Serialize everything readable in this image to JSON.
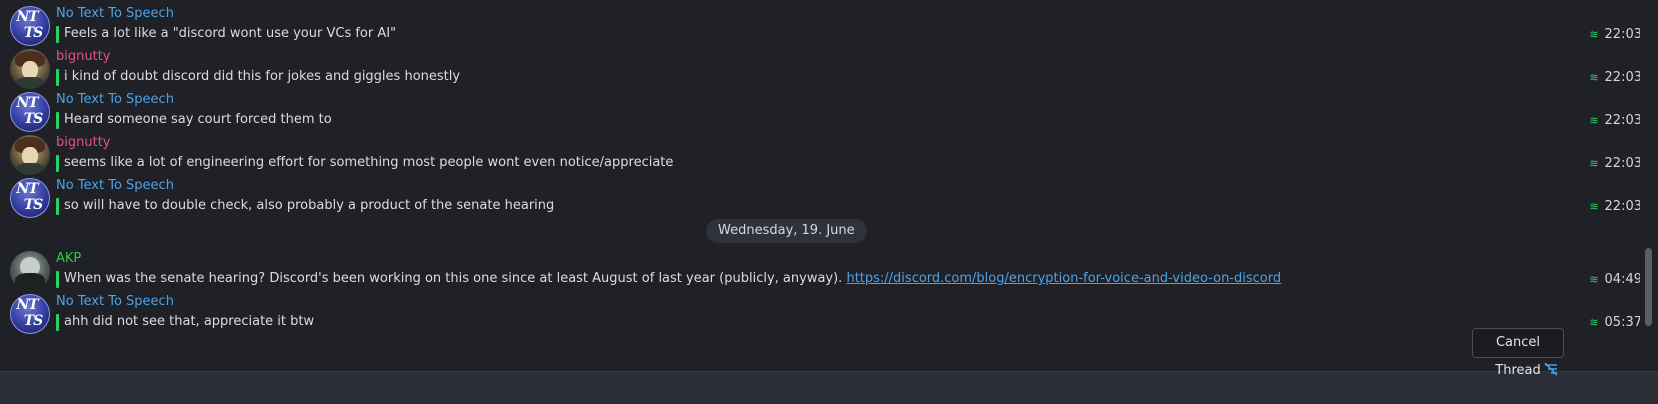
{
  "messages": [
    {
      "sender": "No Text To Speech",
      "sender_color": "#4aa3e8",
      "avatar": "ntts",
      "text": "Feels a lot like a \"discord wont use your VCs for AI\"",
      "time": "22:03"
    },
    {
      "sender": "bignutty",
      "sender_color": "#e0508f",
      "avatar": "bignutty",
      "text": "i kind of doubt discord did this for jokes and giggles honestly",
      "time": "22:03"
    },
    {
      "sender": "No Text To Speech",
      "sender_color": "#4aa3e8",
      "avatar": "ntts",
      "text": "Heard someone say court forced them to",
      "time": "22:03"
    },
    {
      "sender": "bignutty",
      "sender_color": "#e0508f",
      "avatar": "bignutty",
      "text": "seems like a lot of engineering effort for something most people wont even notice/appreciate",
      "time": "22:03"
    },
    {
      "sender": "No Text To Speech",
      "sender_color": "#4aa3e8",
      "avatar": "ntts",
      "text": "so will have to double check, also probably a product of the senate hearing",
      "time": "22:03"
    },
    {
      "sender": "AKP",
      "sender_color": "#2ecc40",
      "avatar": "akp",
      "text": "When was the senate hearing? Discord's been working on this one since at least August of last year (publicly, anyway).",
      "link": "https://discord.com/blog/encryption-for-voice-and-video-on-discord",
      "time": "04:49"
    },
    {
      "sender": "No Text To Speech",
      "sender_color": "#4aa3e8",
      "avatar": "ntts",
      "text": "ahh did not see that, appreciate it btw",
      "time": "05:37"
    }
  ],
  "date_separator": "Wednesday, 19. June",
  "avatar_text": {
    "ntts_line1": "NT",
    "ntts_line2": "TS"
  },
  "composer": {
    "cancel_thread_label": "Cancel Thread",
    "thread_icon": "thread-icon"
  },
  "read_receipt_icon": "≋",
  "colors": {
    "background": "#202127",
    "receipt": "#2fd166",
    "link": "#4aa3e8",
    "reply_bar": "#25d366"
  }
}
